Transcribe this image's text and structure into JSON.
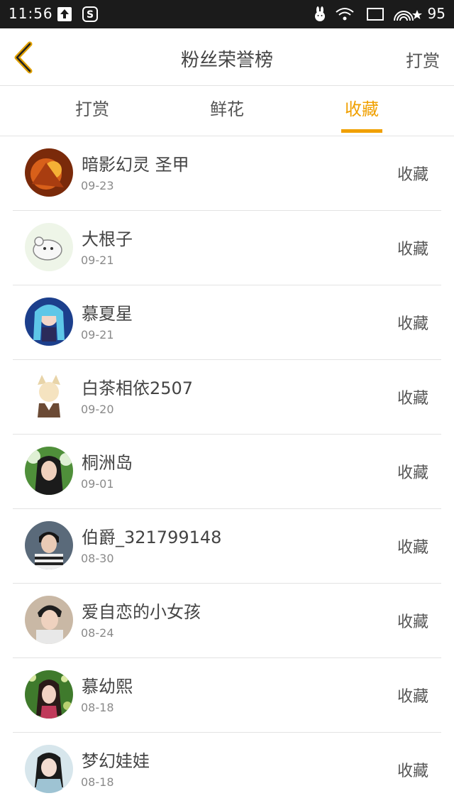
{
  "status_bar": {
    "time": "11:56",
    "battery": "95",
    "icons": [
      "upload-icon",
      "s-app-icon",
      "rabbit-icon",
      "wifi-icon",
      "screen-icon",
      "signal-icon",
      "star-icon"
    ]
  },
  "header": {
    "title": "粉丝荣誉榜",
    "back_icon": "chevron-left-icon",
    "action_label": "打赏"
  },
  "tabs": [
    {
      "label": "打赏",
      "active": false
    },
    {
      "label": "鲜花",
      "active": false
    },
    {
      "label": "收藏",
      "active": true
    }
  ],
  "colors": {
    "accent": "#f0a000",
    "status_bar": "#1b1b1b",
    "text": "#444444",
    "secondary_text": "#8a8a8a",
    "divider": "#e3e3e3"
  },
  "fans": [
    {
      "name": "暗影幻灵 圣甲",
      "date": "09-23",
      "action": "收藏"
    },
    {
      "name": "大根子",
      "date": "09-21",
      "action": "收藏"
    },
    {
      "name": "慕夏星",
      "date": "09-21",
      "action": "收藏"
    },
    {
      "name": "白茶相依2507",
      "date": "09-20",
      "action": "收藏"
    },
    {
      "name": "桐洲岛",
      "date": "09-01",
      "action": "收藏"
    },
    {
      "name": "伯爵_321799148",
      "date": "08-30",
      "action": "收藏"
    },
    {
      "name": "爱自恋的小女孩",
      "date": "08-24",
      "action": "收藏"
    },
    {
      "name": "慕幼熙",
      "date": "08-18",
      "action": "收藏"
    },
    {
      "name": "梦幻娃娃",
      "date": "08-18",
      "action": "收藏"
    }
  ]
}
